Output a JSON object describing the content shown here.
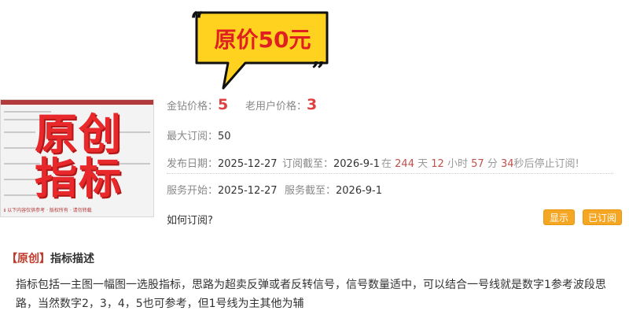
{
  "bubble": {
    "text": "原价50元"
  },
  "thumbnail": {
    "stamp_line1": "原创",
    "stamp_line2": "指标",
    "footer": "ℹ 以下内容仅供参考 · 版权所有 · 请勿转载"
  },
  "prices": {
    "diamond_label": "金钻价格：",
    "diamond_value": "5",
    "old_user_label": "老用户价格：",
    "old_user_value": "3"
  },
  "max_sub": {
    "label": "最大订阅：",
    "value": "50"
  },
  "publish": {
    "date_label": "发布日期：",
    "date_value": "2025-12-27",
    "deadline_label": "订阅截至：",
    "deadline_value": "2026-9-1",
    "countdown": {
      "prefix": "在",
      "days": "244",
      "days_unit": "天",
      "hours": "12",
      "hours_unit": "小时",
      "minutes": "57",
      "minutes_unit": "分",
      "seconds": "34",
      "suffix": "秒后停止订阅!"
    }
  },
  "service": {
    "start_label": "服务开始：",
    "start_value": "2025-12-27",
    "end_label": "服务截至：",
    "end_value": "2026-9-1"
  },
  "how_to": "如何订阅?",
  "buttons": {
    "show": "显示",
    "subscribed": "已订阅"
  },
  "section": {
    "tag": "【原创】",
    "title": "指标描述"
  },
  "description": "指标包括一主图一幅图一选股指标，思路为超卖反弹或者反转信号，信号数量适中，可以结合一号线就是数字1参考波段思路，当然数字2，3，4，5也可参考，但1号线为主其他为辅",
  "colors": {
    "accent_red": "#e04040",
    "button_orange": "#f5a623",
    "bubble_yellow": "#ffd21f"
  }
}
